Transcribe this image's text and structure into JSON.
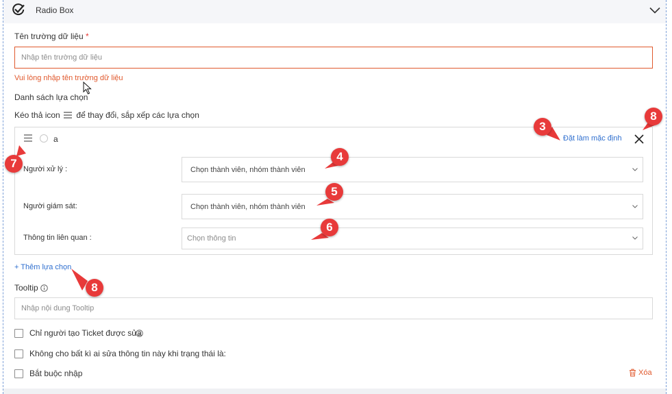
{
  "header": {
    "title": "Radio Box",
    "check_icon": "check-circle-icon",
    "chevron_icon": "chevron-down-icon"
  },
  "field_name": {
    "label": "Tên trường dữ liệu",
    "required_mark": "*",
    "placeholder": "Nhập tên trường dữ liệu",
    "error": "Vui lòng nhập tên trường dữ liệu"
  },
  "choices": {
    "label": "Danh sách lựa chọn",
    "hint_before": "Kéo thả icon",
    "hint_after": "để thay đổi, sắp xếp các lựa chọn",
    "option_value": "a",
    "set_default": "Đặt làm mặc định",
    "rows": [
      {
        "label": "Người xử lý :",
        "value": "Chọn thành viên, nhóm thành viên"
      },
      {
        "label": "Người giám sát:",
        "value": "Chọn thành viên, nhóm thành viên"
      },
      {
        "label": "Thông tin liên quan :",
        "value": "Chọn thông tin"
      }
    ],
    "add_choice": "+ Thêm lựa chọn"
  },
  "tooltip": {
    "label": "Tooltip",
    "placeholder": "Nhập nội dung Tooltip"
  },
  "checkboxes": [
    {
      "label": "Chỉ người tạo Ticket được sửa",
      "checked": false
    },
    {
      "label": "Không cho bất kì ai sửa thông tin này khi trạng thái là:",
      "checked": false
    },
    {
      "label": "Bắt buộc nhập",
      "checked": false
    }
  ],
  "delete_label": "Xóa",
  "annotations": [
    "3",
    "8",
    "7",
    "4",
    "5",
    "6",
    "8"
  ],
  "colors": {
    "accent_link": "#2f6fcf",
    "error": "#e0582c",
    "badge": "#e83a3a"
  }
}
